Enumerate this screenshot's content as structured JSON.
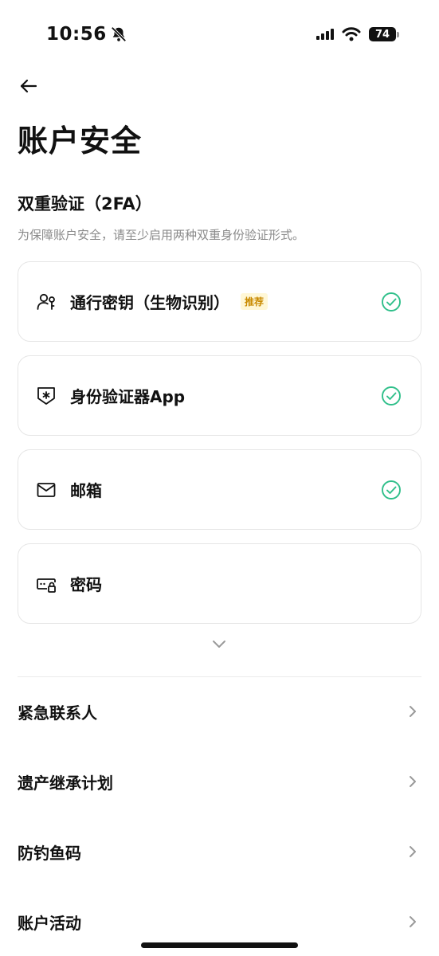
{
  "status": {
    "time": "10:56",
    "battery": "74"
  },
  "header": {
    "title": "账户安全"
  },
  "two_factor": {
    "title": "双重验证（2FA）",
    "subtitle": "为保障账户安全，请至少启用两种双重身份验证形式。",
    "methods": [
      {
        "label": "通行密钥（生物识别）",
        "badge": "推荐",
        "enabled": true,
        "icon": "passkey-icon"
      },
      {
        "label": "身份验证器App",
        "enabled": true,
        "icon": "authenticator-shield-icon"
      },
      {
        "label": "邮箱",
        "enabled": true,
        "icon": "mail-icon"
      },
      {
        "label": "密码",
        "enabled": false,
        "icon": "password-lock-icon"
      }
    ]
  },
  "menu": {
    "items": [
      {
        "label": "紧急联系人"
      },
      {
        "label": "遗产继承计划"
      },
      {
        "label": "防钓鱼码"
      },
      {
        "label": "账户活动"
      }
    ]
  },
  "colors": {
    "check_green": "#2fbf8a",
    "badge_bg": "#fff7d6",
    "badge_text": "#c98a00"
  }
}
